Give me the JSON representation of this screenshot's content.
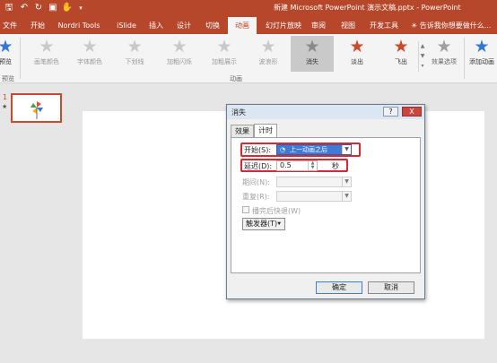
{
  "titlebar": {
    "title": "新建 Microsoft PowerPoint 演示文稿.pptx  -  PowerPoint",
    "quick_access": [
      "save-icon",
      "undo-icon",
      "redo-icon",
      "start-from-beginning-icon",
      "touch-mode-icon"
    ]
  },
  "tabs": [
    {
      "label": "文件"
    },
    {
      "label": "开始"
    },
    {
      "label": "Nordri Tools"
    },
    {
      "label": "iSlide"
    },
    {
      "label": "插入"
    },
    {
      "label": "设计"
    },
    {
      "label": "切换"
    },
    {
      "label": "动画"
    },
    {
      "label": "幻灯片放映"
    },
    {
      "label": "审阅"
    },
    {
      "label": "视图"
    },
    {
      "label": "开发工具"
    }
  ],
  "tell_me": "告诉我你想要做什么...",
  "ribbon": {
    "preview_label": "预览",
    "preview_group": "预览",
    "animation_group": "动画",
    "effects": [
      {
        "label": "画笔颜色"
      },
      {
        "label": "字体颜色"
      },
      {
        "label": "下划线"
      },
      {
        "label": "加粗闪烁"
      },
      {
        "label": "加粗展示"
      },
      {
        "label": "波浪形"
      },
      {
        "label": "消失"
      },
      {
        "label": "淡出"
      },
      {
        "label": "飞出"
      }
    ],
    "effect_options": "效果选项",
    "add_animation": "添加动画"
  },
  "thumbnail": {
    "number": "1",
    "marker": "★"
  },
  "dialog": {
    "title": "消失",
    "help": "?",
    "close": "X",
    "tabs": [
      {
        "label": "效果"
      },
      {
        "label": "计时"
      }
    ],
    "start_label": "开始(S):",
    "start_value": "上一动画之后",
    "delay_label": "延迟(D):",
    "delay_value": "0.5",
    "delay_unit": "秒",
    "duration_label": "期间(N):",
    "repeat_label": "重复(R):",
    "rewind_label": "播完后快退(W)",
    "triggers_label": "触发器(T)",
    "ok": "确定",
    "cancel": "取消"
  }
}
